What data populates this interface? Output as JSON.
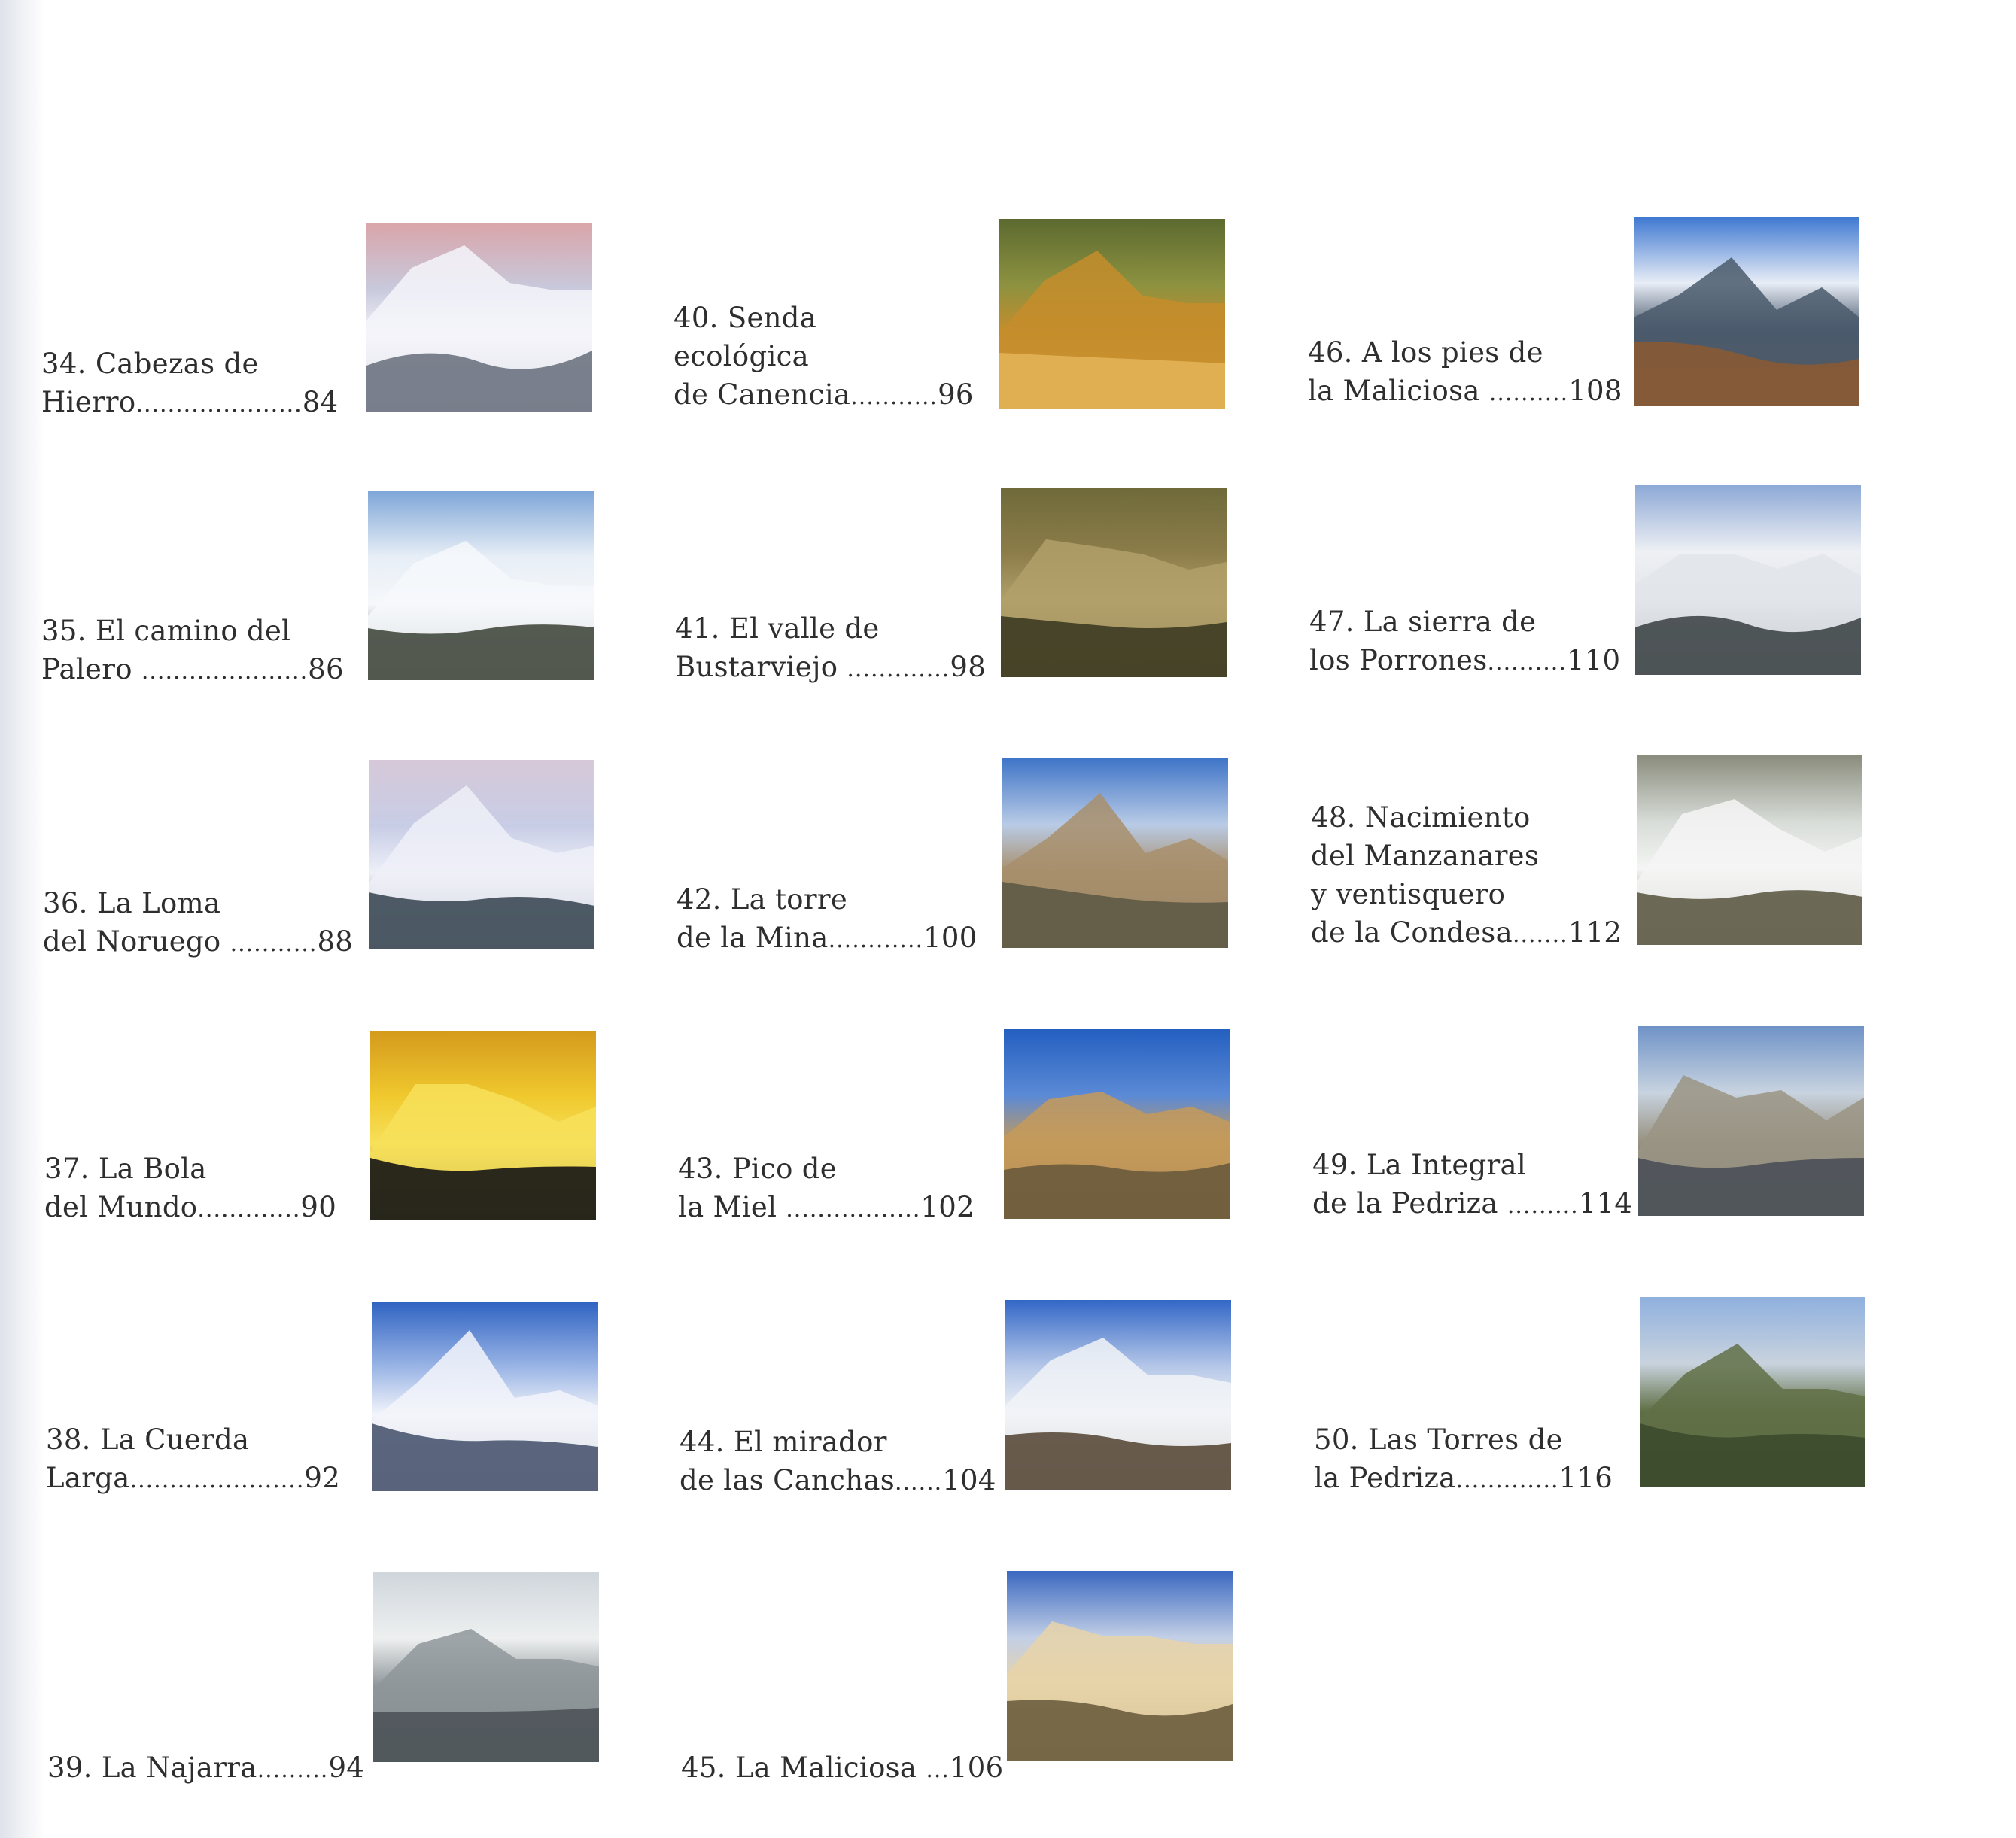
{
  "entries": [
    {
      "num": "34.",
      "lines": [
        "Cabezas de",
        "Hierro"
      ],
      "page": "84",
      "dots": ".....................",
      "photo": "snow-mountain-ridge",
      "colors": [
        "#d9a5a9",
        "#c8c9dc",
        "#f4f5fa",
        "#6d7381"
      ]
    },
    {
      "num": "35.",
      "lines": [
        "El camino del",
        "Palero "
      ],
      "page": "86",
      "dots": ".....................",
      "photo": "snowy-pine-forest",
      "colors": [
        "#7ea6d8",
        "#e7eef6",
        "#f6f8fb",
        "#43493e"
      ]
    },
    {
      "num": "36.",
      "lines": [
        "La Loma",
        "del Noruego "
      ],
      "page": "88",
      "dots": "...........",
      "photo": "snow-slope-antennas",
      "colors": [
        "#d6c8d8",
        "#c8cde6",
        "#eef0f8",
        "#3c4a55"
      ]
    },
    {
      "num": "37.",
      "lines": [
        "La Bola",
        "del Mundo"
      ],
      "page": "90",
      "dots": ".............",
      "photo": "sunset-antenna-silhouette",
      "colors": [
        "#d49a1c",
        "#f0c92e",
        "#f7e05a",
        "#151515"
      ]
    },
    {
      "num": "38.",
      "lines": [
        "La Cuerda",
        "Larga"
      ],
      "page": "92",
      "dots": "......................",
      "photo": "snow-ridge-blue-sky",
      "colors": [
        "#2f63c2",
        "#9cb6e6",
        "#f3f5fa",
        "#4a5670"
      ]
    },
    {
      "num": "39.",
      "lines": [
        "La Najarra"
      ],
      "page": "94",
      "dots": ".........",
      "photo": "frosted-granite-rocks",
      "colors": [
        "#cfd6dc",
        "#eef0f0",
        "#8f969a",
        "#4c5358"
      ]
    },
    {
      "num": "40.",
      "lines": [
        "Senda",
        "ecológica",
        "de Canencia"
      ],
      "page": "96",
      "dots": "...........",
      "photo": "waterfall-autumn-pool",
      "colors": [
        "#5c6a30",
        "#8d9240",
        "#c58d2b",
        "#e1b257"
      ]
    },
    {
      "num": "41.",
      "lines": [
        "El valle de",
        "Bustarviejo "
      ],
      "page": "98",
      "dots": ".............",
      "photo": "autumn-oak-forest",
      "colors": [
        "#6f6a3a",
        "#8c7d4a",
        "#b1a06a",
        "#3d3b22"
      ]
    },
    {
      "num": "42.",
      "lines": [
        "La torre",
        "de la Mina"
      ],
      "page": "100",
      "dots": "............",
      "photo": "stone-tower",
      "colors": [
        "#3f75c8",
        "#b9cbe6",
        "#a88f6c",
        "#5e5a46"
      ]
    },
    {
      "num": "43.",
      "lines": [
        "Pico de",
        "la Miel "
      ],
      "page": "102",
      "dots": ".................",
      "photo": "rocky-peak-blue-sky",
      "colors": [
        "#245fc0",
        "#5b8ad6",
        "#c49a5a",
        "#6a5a3c"
      ]
    },
    {
      "num": "44.",
      "lines": [
        "El mirador",
        "de las Canchas"
      ],
      "page": "104",
      "dots": "......",
      "photo": "snowy-rock-summit",
      "colors": [
        "#3367c7",
        "#b5c7e8",
        "#f1f3f7",
        "#5a4a3a"
      ]
    },
    {
      "num": "45.",
      "lines": [
        "La Maliciosa "
      ],
      "page": "106",
      "dots": "...",
      "photo": "snowy-golden-peak",
      "colors": [
        "#3a68c0",
        "#c2cfe6",
        "#e7d3a8",
        "#6c5d3e"
      ]
    },
    {
      "num": "46.",
      "lines": [
        "A los pies de",
        "la Maliciosa "
      ],
      "page": "108",
      "dots": "..........",
      "photo": "cloudy-mountain-peak",
      "colors": [
        "#3e78d2",
        "#e8edf6",
        "#4a5a6c",
        "#8a5a34"
      ]
    },
    {
      "num": "47.",
      "lines": [
        "La sierra de",
        "los Porrones"
      ],
      "page": "110",
      "dots": "..........",
      "photo": "misty-snowy-peak",
      "colors": [
        "#8da9d6",
        "#eef0f4",
        "#e2e5ea",
        "#3f4648"
      ]
    },
    {
      "num": "48.",
      "lines": [
        "Nacimiento",
        "del Manzanares",
        "y ventisquero",
        "de la Condesa"
      ],
      "page": "112",
      "dots": ".......",
      "photo": "river-rapids-granite",
      "colors": [
        "#8a8d7c",
        "#d8dcd8",
        "#f4f5f4",
        "#5d5a46"
      ]
    },
    {
      "num": "49.",
      "lines": [
        "La Integral",
        "de la Pedriza "
      ],
      "page": "114",
      "dots": ".........",
      "photo": "granite-ridges-clouds",
      "colors": [
        "#6f93c7",
        "#c8d3e0",
        "#9a9484",
        "#4a5058"
      ]
    },
    {
      "num": "50.",
      "lines": [
        "Las Torres de",
        "la Pedriza"
      ],
      "page": "116",
      "dots": ".............",
      "photo": "pedriza-valley",
      "colors": [
        "#8fb0de",
        "#c9d3de",
        "#607046",
        "#3b4a2c"
      ]
    }
  ]
}
